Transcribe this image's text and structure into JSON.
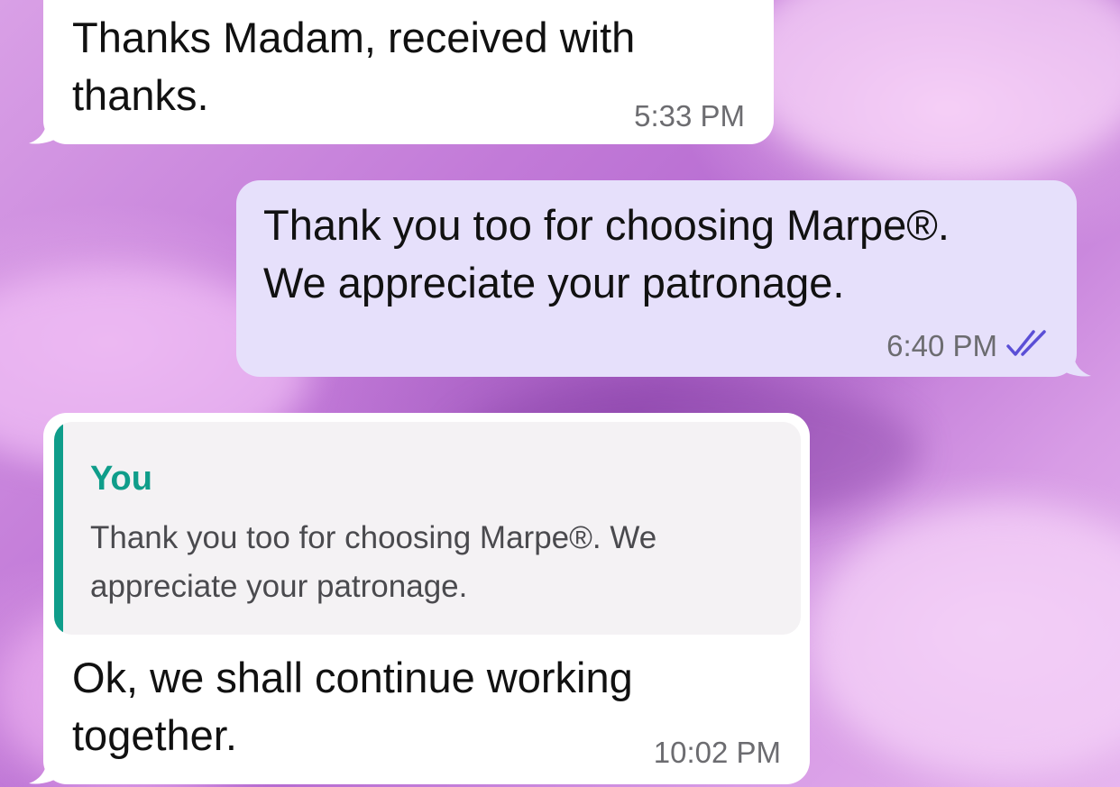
{
  "chat": {
    "messages": [
      {
        "id": "msg-1",
        "direction": "incoming",
        "text": "Thanks Madam, received with\nthanks.",
        "time": "5:33 PM"
      },
      {
        "id": "msg-2",
        "direction": "outgoing",
        "text": "Thank you too for choosing Marpe®.\nWe appreciate your patronage.",
        "time": "6:40 PM",
        "status_icon": "double-check-read-icon"
      },
      {
        "id": "msg-3",
        "direction": "incoming",
        "reply": {
          "author": "You",
          "text": "Thank you too for choosing Marpe®. We\nappreciate your patronage."
        },
        "text": "Ok, we shall continue working\ntogether.",
        "time": "10:02 PM"
      }
    ]
  },
  "colors": {
    "incoming_bubble": "#ffffff",
    "outgoing_bubble": "#e6e0fb",
    "reply_accent": "#0f9d8a",
    "read_check": "#5b4fd6",
    "timestamp": "#6c6c70"
  }
}
